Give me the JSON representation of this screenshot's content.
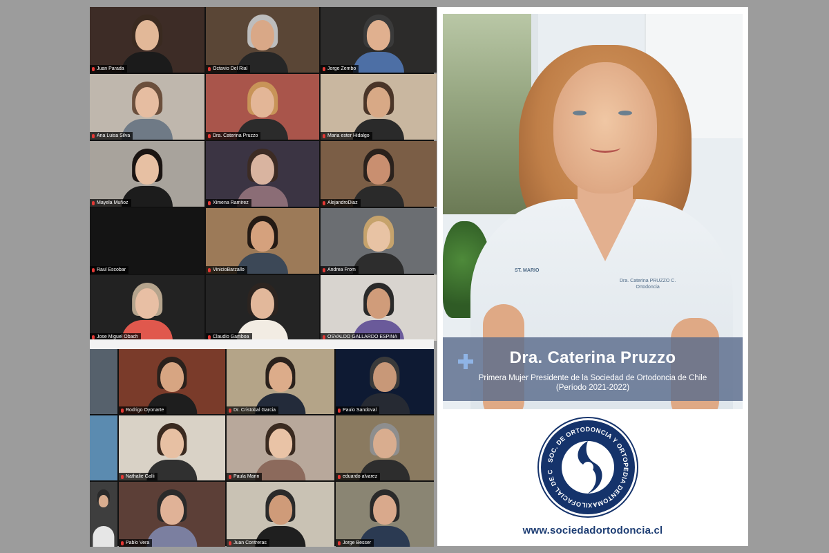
{
  "grid_top": [
    {
      "name": "Juan Parada",
      "bg": "#3d2c26",
      "skin": "#e2b898",
      "shirt": "#1b1b1b",
      "hair": "#3a2a20"
    },
    {
      "name": "Octavio Del Rial",
      "bg": "#5a4636",
      "skin": "#d9a887",
      "shirt": "#262626",
      "hair": "#bdbdbd"
    },
    {
      "name": "Jorge Zembo",
      "bg": "#2c2b2a",
      "skin": "#e0b08f",
      "shirt": "#4d6fa5",
      "hair": "#3a3a3a"
    },
    {
      "name": "Ana Luisa Silva",
      "bg": "#bfb7ad",
      "skin": "#e6bda1",
      "shirt": "#6f7a86",
      "hair": "#6b4f3c"
    },
    {
      "name": "Dra. Caterina Pruzzo",
      "bg": "#a9554b",
      "skin": "#e3b697",
      "shirt": "#2b2b2b",
      "hair": "#c89458"
    },
    {
      "name": "Maria ester Hidalgo",
      "bg": "#c9b7a0",
      "skin": "#d8a986",
      "shirt": "#2a2a2a",
      "hair": "#4a3528"
    },
    {
      "name": "Mayela Muñoz",
      "bg": "#a8a39c",
      "skin": "#e7c0a3",
      "shirt": "#1c1c1c",
      "hair": "#1a1412"
    },
    {
      "name": "Ximena Ramirez",
      "bg": "#3b3443",
      "skin": "#d9b4a0",
      "shirt": "#8b6d76",
      "hair": "#3c2b24"
    },
    {
      "name": "AlejandroDiaz",
      "bg": "#7b5e46",
      "skin": "#c98f70",
      "shirt": "#2a2a2a",
      "hair": "#2a211c"
    },
    {
      "name": "Raul Escobar",
      "bg": "#141414",
      "skin": "",
      "shirt": "",
      "hair": ""
    },
    {
      "name": "VinicioBarzallo",
      "bg": "#9c7a58",
      "skin": "#d5a17d",
      "shirt": "#3c4857",
      "hair": "#241a14"
    },
    {
      "name": "Andrea From",
      "bg": "#6b6e72",
      "skin": "#e8c3a4",
      "shirt": "#2d2d2d",
      "hair": "#c6a36c"
    },
    {
      "name": "Jose Miguel Obach",
      "bg": "#222222",
      "skin": "#e8bfa4",
      "shirt": "#e0584d",
      "hair": "#b5a48d"
    },
    {
      "name": "Claudio Gamboa",
      "bg": "#242424",
      "skin": "#e2b89b",
      "shirt": "#f2ece3",
      "hair": "#2c2420"
    },
    {
      "name": "OSVALDO GALLARDO ESPINA",
      "bg": "#d8d4cf",
      "skin": "#d09c7a",
      "shirt": "#6a5a9a",
      "hair": "#2a2a2a"
    }
  ],
  "grid_bottom": [
    {
      "name": "",
      "bg": "#56616c",
      "skin": "",
      "shirt": "",
      "hair": ""
    },
    {
      "name": "Rodrigo Oyonarte",
      "bg": "#7a3b2a",
      "skin": "#d7a582",
      "shirt": "#1e1e1e",
      "hair": "#2a211c"
    },
    {
      "name": "Dr. Cristobal Garcia",
      "bg": "#b4a488",
      "skin": "#dcac8a",
      "shirt": "#232b3a",
      "hair": "#2a211c"
    },
    {
      "name": "Paulo Sandoval",
      "bg": "#0e1a33",
      "skin": "#c89878",
      "shirt": "#262a33",
      "hair": "#3a3a3a"
    },
    {
      "name": "",
      "bg": "#5b8bb0",
      "skin": "",
      "shirt": "",
      "hair": ""
    },
    {
      "name": "Nathalie Galli",
      "bg": "#d9d2c6",
      "skin": "#e7c0a3",
      "shirt": "#303030",
      "hair": "#3a2a20"
    },
    {
      "name": "Paula Marin",
      "bg": "#b8a89b",
      "skin": "#e9c3a6",
      "shirt": "#8c6a5c",
      "hair": "#3a2a20"
    },
    {
      "name": "eduardo alvarez",
      "bg": "#8a7a60",
      "skin": "#d9ad8f",
      "shirt": "#2d2d2d",
      "hair": "#8e8e8e"
    },
    {
      "name": "",
      "bg": "#3e3e3e",
      "skin": "#d9ad8f",
      "shirt": "#e6e6e6",
      "hair": "#2a2a2a"
    },
    {
      "name": "Pablo Vera",
      "bg": "#5c3f37",
      "skin": "#e0b297",
      "shirt": "#7b7fa0",
      "hair": "#2a2a2a"
    },
    {
      "name": "Juan Contreras",
      "bg": "#c9c2b4",
      "skin": "#cf9b79",
      "shirt": "#1f1f1f",
      "hair": "#2a2a2a"
    },
    {
      "name": "Jorge Besser",
      "bg": "#8a8573",
      "skin": "#d9a98c",
      "shirt": "#2b3a52",
      "hair": "#2a2a2a"
    }
  ],
  "poster": {
    "name": "Dra. Caterina Pruzzo",
    "subtitle_line1": "Primera Mujer Presidente de la Sociedad de Ortodoncia de Chile",
    "subtitle_line2": "(Período 2021-2022)",
    "badge_left": "ST. MARIO",
    "badge_right_line1": "Dra. Caterina PRUZZO C.",
    "badge_right_line2": "Ortodoncia",
    "logo_text": "SOC. DE ORTODONCIA Y ORTOPEDIA DENTOMAXILOFACIAL DE CHILE",
    "website": "www.sociedadortodoncia.cl"
  },
  "colors": {
    "background": "#9c9c9c",
    "caption_band": "#5c6c8c",
    "logo_blue": "#15336b",
    "mic_muted": "#e53935"
  }
}
